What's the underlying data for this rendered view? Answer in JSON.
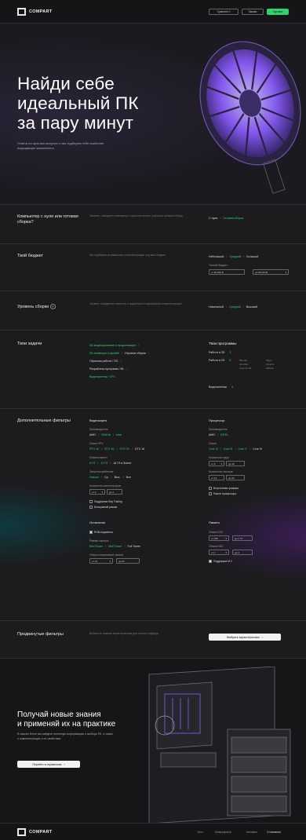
{
  "header": {
    "logo": "COMPART",
    "btn_compare": "Сравнить 0",
    "btn_favorites": "Заказы",
    "btn_cart": "Корзина"
  },
  "hero": {
    "title_line1": "Найди себе",
    "title_line2": "идеальный ПК",
    "title_line3": "за пару минут",
    "subtitle": "Ответь на простые вопросы и мы подберем тебе наиболее подходящие компоненты"
  },
  "q_build": {
    "title": "Компьютер с нуля или готовая сборка?",
    "desc": "Укажите, собираете компьютер с нуля или хотите улучшить готовую сборку",
    "opt1": "С нуля",
    "opt2": "Готовая сборка"
  },
  "q_budget": {
    "title": "Твой бюджет",
    "desc": "Мы подберем оптимальные комплектующие под ваш бюджет",
    "opt1": "Небольшой",
    "opt2": "Средний",
    "opt3": "Большой",
    "range_label": "Точный бюджет",
    "from": "от 48 000 ₽",
    "to": "до 80 000 ₽"
  },
  "q_level": {
    "title": "Уровень сборки",
    "help": "?",
    "desc": "Уровень определяет качество и надежность подобранных комплектующих",
    "opt1": "Начальный",
    "opt2": "Средний",
    "opt3": "Высокий"
  },
  "q_tasks": {
    "title": "Твои задачи",
    "tasks": [
      "3D-моделирование и визуализация",
      "3D-анимация и дизайн",
      "Игровые сборки",
      "Офисная работа / ПО",
      "Разработка программ / ML",
      "Видеомонтаж / VFX"
    ],
    "programs_title": "Твои программы",
    "program_rows": [
      {
        "label": "Работа в 3D",
        "value": "3"
      },
      {
        "label": "Работа в 2D",
        "value": "6"
      },
      {
        "label": "Видеомонтаж",
        "value": "4"
      }
    ],
    "program_list": [
      "Blender",
      "3ds Max",
      "Cinema 4D",
      "Maya",
      "Houdini",
      "ZBrush"
    ]
  },
  "q_filters": {
    "title": "Дополнительные фильтры",
    "video_title": "Видеокарта",
    "video_maker_label": "Производитель",
    "video_makers": [
      "AMD",
      "NVIDIA",
      "Intel"
    ],
    "video_series_label": "Серия GPU",
    "video_series": [
      "RTX 40",
      "RTX 30",
      "RTX 20",
      "GTX 16"
    ],
    "vram_label": "Объем памяти",
    "vram": [
      "8 Гб",
      "12 Гб",
      "16 Гб и более"
    ],
    "power_label": "Энергопотребление",
    "power": [
      "Низкое",
      "Ср.",
      "Выс.",
      "Все"
    ],
    "fan_label": "Количество вентиляторов",
    "fan_from": "от 2",
    "fan_to": "до 3",
    "chk1": "Поддержка Ray Tracing",
    "chk2": "Бесшумный режим",
    "cpu_title": "Процессор",
    "cpu_maker_label": "Производитель",
    "cpu_makers": [
      "AMD",
      "INTEL"
    ],
    "cpu_series_label": "Серия",
    "cpu_series": [
      "Core i3",
      "Core i5",
      "Core i7",
      "Core i9"
    ],
    "cores_label": "Количество ядер",
    "cores_from": "от 6",
    "cores_to": "до 16",
    "threads_label": "Количество потоков",
    "threads_from": "от 12",
    "threads_to": "до 32",
    "cpu_chk1": "Встроенная графика",
    "cpu_chk2": "Разгон процессора",
    "other_title": "Остальное",
    "other_chk": "RGB-подсветка",
    "case_label": "Размер корпуса",
    "case_opts": [
      "Mini Tower",
      "Midi Tower",
      "Full Tower"
    ],
    "ram_label": "Объем оперативной памяти",
    "ram_from": "от 16",
    "ram_to": "до 64",
    "mem_title": "Память",
    "ssd_label": "Объем SSD",
    "ssd_from": "от 256",
    "ssd_to": "до 2 Тб",
    "hdd_label": "Объем HDD",
    "hdd_from": "от 1",
    "hdd_to": "до 4",
    "nvme_chk": "Поддержка M.2"
  },
  "q_advanced": {
    "title": "Продвинутые фильтры",
    "desc": "Выберите нужные характеристики для точного подбора",
    "button": "Выбрать характеристики"
  },
  "promo": {
    "title_line1": "Получай новые знания",
    "title_line2": "и применяй их на практике",
    "text": "В нашем блоге вы найдете полезную информацию о выборе ПК, а также о комплектующих и их свойствах",
    "button": "Перейти в справочник"
  },
  "footer": {
    "logo": "COMPART",
    "links": [
      "Блог",
      "Конфигуратор",
      "Контакты",
      "О компании"
    ]
  },
  "colors": {
    "accent": "#2dd36f",
    "background": "#1c1c1f",
    "purple": "#8a5cff"
  }
}
